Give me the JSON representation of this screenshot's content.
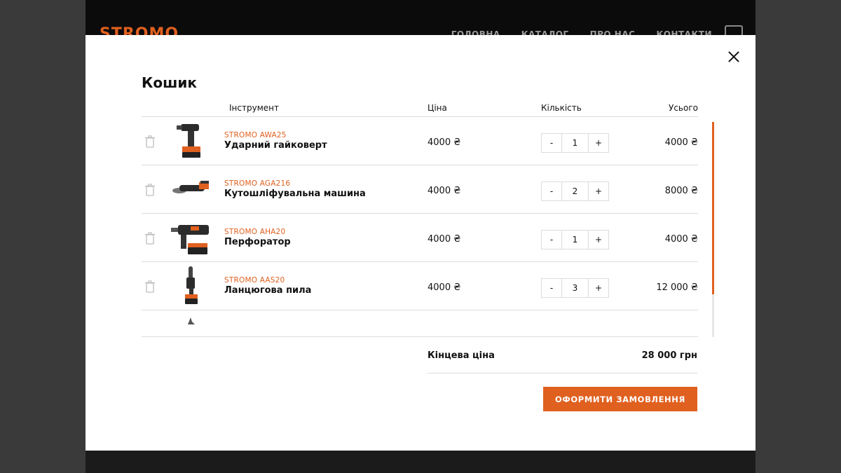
{
  "background": {
    "logo": "STROMO",
    "nav": [
      "ГОЛОВНА",
      "КАТАЛОГ",
      "ПРО НАС",
      "КОНТАКТИ"
    ]
  },
  "cart": {
    "title": "Кошик",
    "columns": {
      "tool": "Інструмент",
      "price": "Ціна",
      "quantity": "Кількість",
      "total": "Усього"
    },
    "items": [
      {
        "brand": "STROMO AWA25",
        "name": "Ударний гайковерт",
        "price": "4000 ₴",
        "qty": "1",
        "total": "4000 ₴",
        "minus": "-",
        "plus": "+"
      },
      {
        "brand": "STROMO AGA216",
        "name": "Кутошліфувальна машина",
        "price": "4000 ₴",
        "qty": "2",
        "total": "8000 ₴",
        "minus": "-",
        "plus": "+"
      },
      {
        "brand": "STROMO AHA20",
        "name": "Перфоратор",
        "price": "4000 ₴",
        "qty": "1",
        "total": "4000 ₴",
        "minus": "-",
        "plus": "+"
      },
      {
        "brand": "STROMO AAS20",
        "name": "Ланцюгова пила",
        "price": "4000 ₴",
        "qty": "3",
        "total": "12 000 ₴",
        "minus": "-",
        "plus": "+"
      }
    ],
    "summary": {
      "label": "Кінцева ціна",
      "value": "28 000 грн"
    },
    "order_button": "ОФОРМИТИ ЗАМОВЛЕННЯ"
  },
  "colors": {
    "accent": "#e0601f",
    "overlay": "#3a3a3a"
  }
}
